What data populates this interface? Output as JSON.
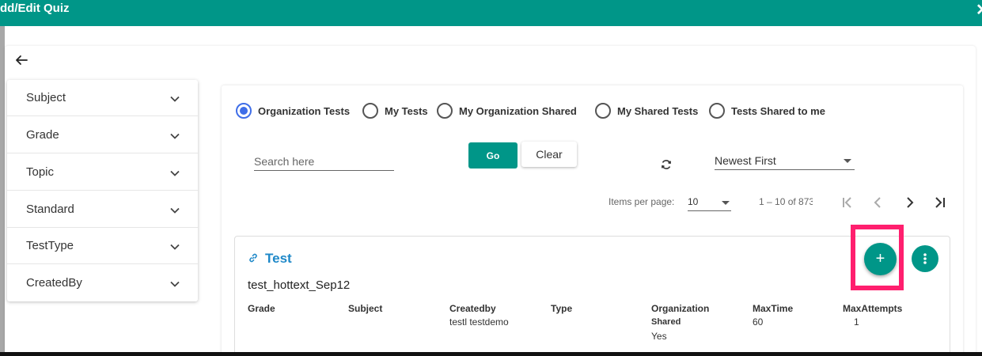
{
  "colors": {
    "primary": "#009688",
    "radio_selected": "#3f6ee8",
    "highlight": "#ff1f6e",
    "link": "#1e88c8"
  },
  "dialog": {
    "title": "dd/Edit Quiz",
    "close_icon": "close-icon"
  },
  "nav": {
    "back_icon": "arrow-left-icon"
  },
  "filters": [
    {
      "label": "Subject"
    },
    {
      "label": "Grade"
    },
    {
      "label": "Topic"
    },
    {
      "label": "Standard"
    },
    {
      "label": "TestType"
    },
    {
      "label": "CreatedBy"
    }
  ],
  "radios": [
    {
      "label": "Organization Tests",
      "selected": true
    },
    {
      "label": "My Tests",
      "selected": false
    },
    {
      "label": "My Organization Shared",
      "selected": false
    },
    {
      "label": "My Shared Tests",
      "selected": false
    },
    {
      "label": "Tests Shared to me",
      "selected": false
    }
  ],
  "search": {
    "placeholder": "Search here",
    "value": ""
  },
  "buttons": {
    "go": "Go",
    "clear": "Clear"
  },
  "sort": {
    "selected": "Newest First"
  },
  "pagination": {
    "items_per_page_label": "Items per page:",
    "items_per_page": "10",
    "range": "1 – 10 of 873"
  },
  "card": {
    "title": "Test",
    "subtitle": "test_hottext_Sep12",
    "columns": {
      "grade": {
        "header": "Grade",
        "value": ""
      },
      "subject": {
        "header": "Subject",
        "value": ""
      },
      "createdby": {
        "header": "Createdby",
        "value": "testl testdemo"
      },
      "type": {
        "header": "Type",
        "value": ""
      },
      "org_shared": {
        "header_line1": "Organization",
        "header_line2": "Shared",
        "value": "Yes"
      },
      "maxtime": {
        "header": "MaxTime",
        "value": "60"
      },
      "maxattempts": {
        "header": "MaxAttempts",
        "value": "1"
      }
    },
    "add_button": "+"
  }
}
